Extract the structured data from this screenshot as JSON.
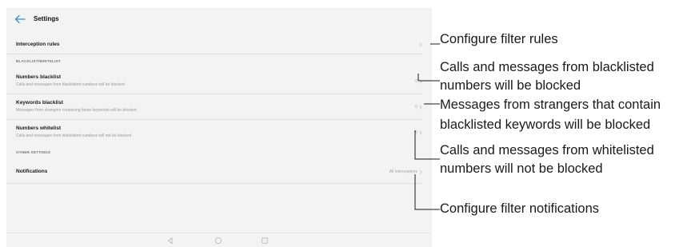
{
  "header": {
    "title": "Settings",
    "back_icon": "arrow-left-icon"
  },
  "rows": {
    "interception": {
      "title": "Interception rules"
    },
    "section_blacklist": "BLACKLIST/WHITELIST",
    "numbers_blacklist": {
      "title": "Numbers blacklist",
      "subtitle": "Calls and messages from blacklisted numbers will be blocked",
      "value": "0"
    },
    "keywords_blacklist": {
      "title": "Keywords blacklist",
      "subtitle": "Messages from strangers containing these keywords will be blocked",
      "value": "0"
    },
    "numbers_whitelist": {
      "title": "Numbers whitelist",
      "subtitle": "Calls and messages from whitelisted numbers will not be blocked",
      "value": "0"
    },
    "section_other": "OTHER SETTINGS",
    "notifications": {
      "title": "Notifications",
      "value": "All interceptions"
    }
  },
  "navbar": {
    "icons": [
      "back-triangle-icon",
      "home-circle-icon",
      "recents-square-icon"
    ]
  },
  "callouts": {
    "rules": "Configure filter rules",
    "blacklist_line1": "Calls and messages from blacklisted",
    "blacklist_line2": "numbers will be blocked",
    "keywords_line1": "Messages from strangers that contain",
    "keywords_line2": "blacklisted keywords will be blocked",
    "whitelist_line1": "Calls and messages from whitelisted",
    "whitelist_line2": "numbers will not be blocked",
    "notifications": "Configure filter notifications"
  },
  "colors": {
    "screen_bg": "#f3f3f3",
    "accent": "#3a8fd6",
    "callout_line": "#1a1a1a"
  }
}
